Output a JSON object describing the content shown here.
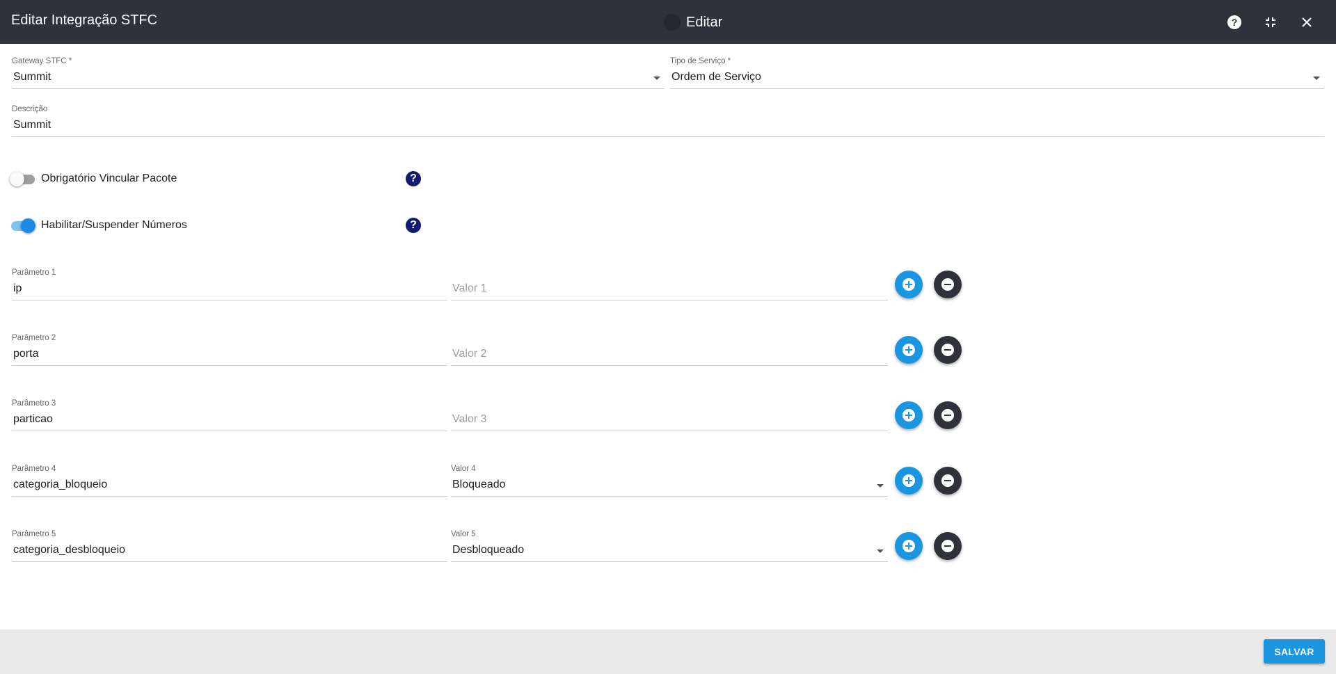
{
  "header": {
    "title": "Editar Integração STFC",
    "mode_label": "Editar",
    "icons": [
      "help-icon",
      "fullscreen-exit-icon",
      "close-icon"
    ]
  },
  "form": {
    "gateway": {
      "label": "Gateway STFC *",
      "value": "Summit"
    },
    "tipo_servico": {
      "label": "Tipo de Serviço *",
      "value": "Ordem de Serviço"
    },
    "descricao": {
      "label": "Descrição",
      "value": "Summit"
    },
    "toggles": [
      {
        "label": "Obrigatório Vincular Pacote",
        "on": false
      },
      {
        "label": "Habilitar/Suspender Números",
        "on": true
      }
    ],
    "parametros": [
      {
        "param_label": "Parâmetro 1",
        "param_value": "ip",
        "valor_label": "",
        "valor_value": "",
        "valor_placeholder": "Valor 1"
      },
      {
        "param_label": "Parâmetro 2",
        "param_value": "porta",
        "valor_label": "",
        "valor_value": "",
        "valor_placeholder": "Valor 2"
      },
      {
        "param_label": "Parâmetro 3",
        "param_value": "particao",
        "valor_label": "",
        "valor_value": "",
        "valor_placeholder": "Valor 3"
      },
      {
        "param_label": "Parâmetro 4",
        "param_value": "categoria_bloqueio",
        "valor_label": "Valor 4",
        "valor_value": "Bloqueado",
        "valor_placeholder": ""
      },
      {
        "param_label": "Parâmetro 5",
        "param_value": "categoria_desbloqueio",
        "valor_label": "Valor 5",
        "valor_value": "Desbloqueado",
        "valor_placeholder": ""
      }
    ]
  },
  "footer": {
    "save_label": "SALVAR"
  },
  "colors": {
    "header_bg": "#2f323a",
    "accent": "#1a96e0",
    "help_circle": "#111c6e"
  }
}
